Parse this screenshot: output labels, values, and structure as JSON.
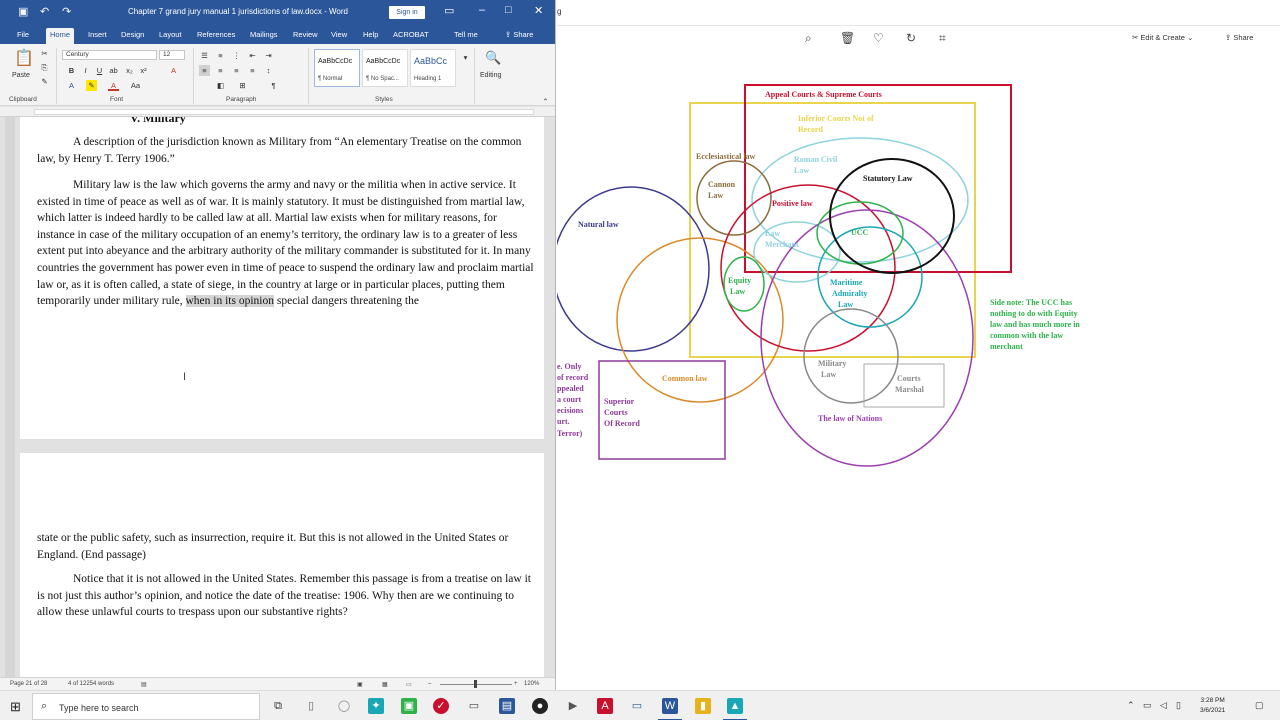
{
  "word": {
    "qat": {
      "autosave": "▣",
      "undo": "↶",
      "redo": "↷"
    },
    "title": "Chapter 7 grand jury manual 1 jurisdictions of law.docx - Word",
    "sign_in": "Sign in",
    "tabs": [
      "File",
      "Home",
      "Insert",
      "Design",
      "Layout",
      "References",
      "Mailings",
      "Review",
      "View",
      "Help",
      "ACROBAT",
      "Tell me"
    ],
    "share": "Share",
    "ribbon": {
      "paste": "Paste",
      "font_name": "Century",
      "font_size": "12",
      "groups": [
        "Clipboard",
        "Font",
        "Paragraph",
        "Styles"
      ],
      "styles": [
        {
          "sample": "AaBbCcDc",
          "name": "¶ Normal"
        },
        {
          "sample": "AaBbCcDc",
          "name": "¶ No Spac..."
        },
        {
          "sample": "AaBbCc",
          "name": "Heading 1"
        }
      ],
      "editing": "Editing"
    },
    "heading": "V.  Military",
    "paragraphs": [
      "A description of the jurisdiction known as Military from “An elementary Treatise on the common law, by Henry T. Terry 1906.”",
      "Military law is the law which governs the army and navy or the militia when in active service. It existed in time of peace as well as of war. It is mainly statutory. It must be distinguished from martial law, which latter is indeed hardly to be called law at all. Martial law exists when for military reasons, for instance in case of the military occupation of an enemy’s territory, the ordinary law is to a greater of less extent put into abeyance and the arbitrary authority of the military commander is substituted for it. In many countries the government has power even in time of peace to suspend the ordinary law and proclaim martial law or, as it is often called, a state of siege, in the country at large or in particular places, putting them temporarily under military rule,",
      "when in its opinion",
      "special dangers threatening the",
      "state or the public safety, such as insurrection, require it. But this is not allowed in the United States or England. (End passage)",
      "Notice that it is not allowed in the United States. Remember this passage is from a treatise on law it is not just this author’s opinion, and notice the date of the treatise: 1906. Why then are we continuing to allow these unlawful courts to trespass upon our substantive rights?"
    ],
    "status": {
      "page": "Page 21 of 28",
      "words": "4 of 12254 words",
      "zoom": "120%"
    }
  },
  "viewer": {
    "label": "g",
    "icons": [
      "zoom-icon",
      "trash-icon",
      "heart-icon",
      "rotate-icon",
      "crop-icon"
    ],
    "edit_create": "Edit & Create",
    "share": "Share",
    "diagram_labels": {
      "appeal": "Appeal Courts & Supreme Courts",
      "inferior1": "Inferior Courts Not of",
      "inferior2": "Record",
      "ecclesiastical": "Ecclesiastical law",
      "roman1": "Roman Civil",
      "roman2": "Law",
      "statutory": "Statutory Law",
      "canon1": "Cannon",
      "canon2": "Law",
      "positive": "Positive law",
      "natural": "Natural law",
      "ucc": "UCC",
      "merchant1": "Law",
      "merchant2": "Merchant",
      "equity1": "Equity",
      "equity2": "Law",
      "maritime1": "Maritime",
      "maritime2": "Admiralty",
      "maritime3": "Law",
      "common": "Common law",
      "military1": "Military",
      "military2": "Law",
      "martial1": "Courts",
      "martial2": "Marshal",
      "nations": "The law of Nations",
      "superior1": "Superior",
      "superior2": "Courts",
      "superior3": "Of Record",
      "left1": "e. Only",
      "left2": "of record",
      "left3": "ppealed",
      "left4": "a court",
      "left5": "ecisions",
      "left6": "urt.",
      "left7": "Terror)",
      "side1": "Side note: The UCC has",
      "side2": "nothing to do with Equity",
      "side3": "law and has much more in",
      "side4": "common with the law",
      "side5": "merchant"
    },
    "colors": {
      "appeal": "#c8102e",
      "inferior": "#e8d44d",
      "roman": "#8fd3de",
      "statutory": "#111111",
      "natural": "#3c3a8f",
      "common": "#d98b2b",
      "positive": "#c8102e",
      "ucc": "#2db34a",
      "maritime": "#1aa7b5",
      "nations": "#9b3fb0",
      "military": "#888888",
      "superior": "#8e3a9a",
      "canon": "#8a6d3b",
      "side_note": "#2db34a"
    }
  },
  "taskbar": {
    "search_placeholder": "Type here to search",
    "time": "3:28 PM",
    "date": "3/6/2021"
  }
}
